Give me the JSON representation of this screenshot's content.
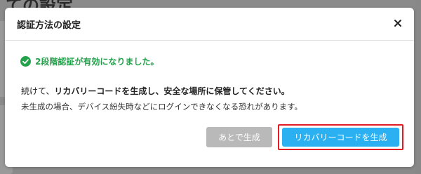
{
  "background": {
    "heading_fragment": "ての設定"
  },
  "modal": {
    "title": "認証方法の設定",
    "close_icon": "close-icon",
    "success": {
      "icon": "check-circle-icon",
      "text": "2段階認証が有効になりました。",
      "color": "#24a14b"
    },
    "message": {
      "line1_prefix": "続けて、",
      "line1_strong": "リカバリーコードを生成し、安全な場所に保管してください。",
      "line2": "未生成の場合、デバイス紛失時などにログインできなくなる恐れがあります。"
    },
    "buttons": {
      "later_label": "あとで生成",
      "generate_label": "リカバリーコードを生成"
    },
    "colors": {
      "primary": "#2bb0f2",
      "disabled": "#b9b9b9",
      "highlight": "#e31b23"
    }
  }
}
